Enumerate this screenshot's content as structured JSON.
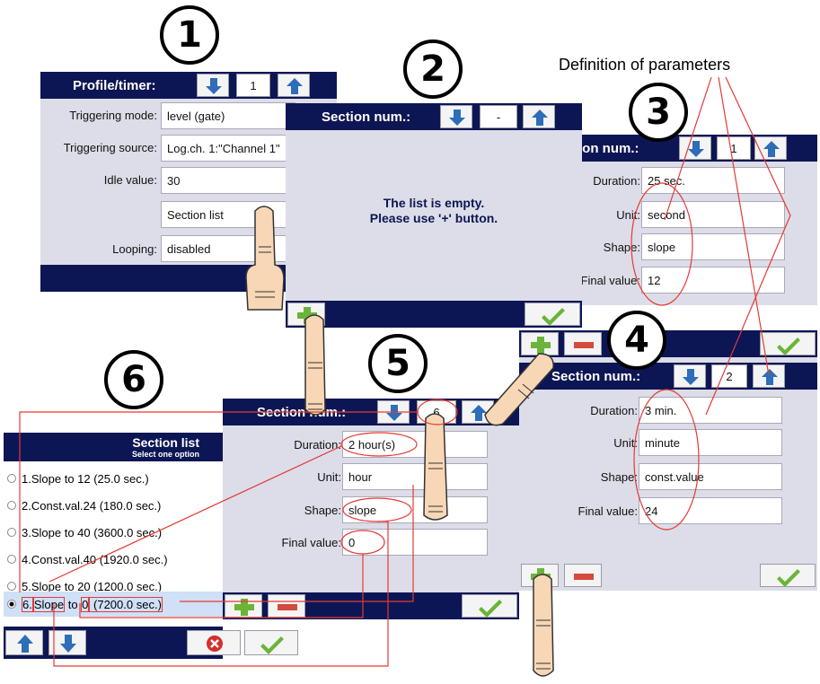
{
  "callout": "Definition of parameters",
  "step_numbers": [
    "1",
    "2",
    "3",
    "4",
    "5",
    "6"
  ],
  "panel1": {
    "title": "Profile/timer:",
    "number": "1",
    "rows": [
      {
        "label": "Triggering mode:",
        "value": "level (gate)"
      },
      {
        "label": "Triggering source:",
        "value": "Log.ch. 1:\"Channel 1\""
      },
      {
        "label": "Idle value:",
        "value": "30"
      },
      {
        "label": "",
        "value": "Section list"
      },
      {
        "label": "Looping:",
        "value": "disabled"
      }
    ]
  },
  "panel2": {
    "title": "Section num.:",
    "number": "-",
    "message_line1": "The list is empty.",
    "message_line2": "Please use '+' button."
  },
  "panel3": {
    "title": "ion num.:",
    "number": "1",
    "rows": [
      {
        "label": "Duration:",
        "value": "25 sec."
      },
      {
        "label": "Unit:",
        "value": "second"
      },
      {
        "label": "Shape:",
        "value": "slope"
      },
      {
        "label": "Final value:",
        "value": "12"
      }
    ]
  },
  "panel4": {
    "title": "Section num.:",
    "number": "2",
    "rows": [
      {
        "label": "Duration:",
        "value": "3 min."
      },
      {
        "label": "Unit:",
        "value": "minute"
      },
      {
        "label": "Shape:",
        "value": "const.value"
      },
      {
        "label": "Final value:",
        "value": "24"
      }
    ]
  },
  "panel5": {
    "title": "Section num.:",
    "number": "6",
    "rows": [
      {
        "label": "Duration:",
        "value": "2 hour(s)"
      },
      {
        "label": "Unit:",
        "value": "hour"
      },
      {
        "label": "Shape:",
        "value": "slope"
      },
      {
        "label": "Final value:",
        "value": "0"
      }
    ]
  },
  "panel6": {
    "title": "Section list",
    "subtitle": "Select one option",
    "items": [
      "1.Slope to 12 (25.0 sec.)",
      "2.Const.val.24 (180.0 sec.)",
      "3.Slope to 40 (3600.0 sec.)",
      "4.Const.val.40 (1920.0 sec.)",
      "5.Slope to 20 (1200.0 sec.)"
    ],
    "selected_parts": [
      "6.",
      "Slope",
      " to ",
      "0",
      " (7200.0 sec.)"
    ]
  },
  "colors": {
    "header": "#0d1654",
    "panel": "#dcdde8",
    "arrow": "#2e6db8",
    "ok": "#6ab43a",
    "minus": "#d24b3c",
    "annotation": "#e53935"
  },
  "icons": [
    "arrow-down-icon",
    "arrow-up-icon",
    "plus-icon",
    "minus-icon",
    "check-icon",
    "cancel-icon",
    "finger-icon"
  ]
}
